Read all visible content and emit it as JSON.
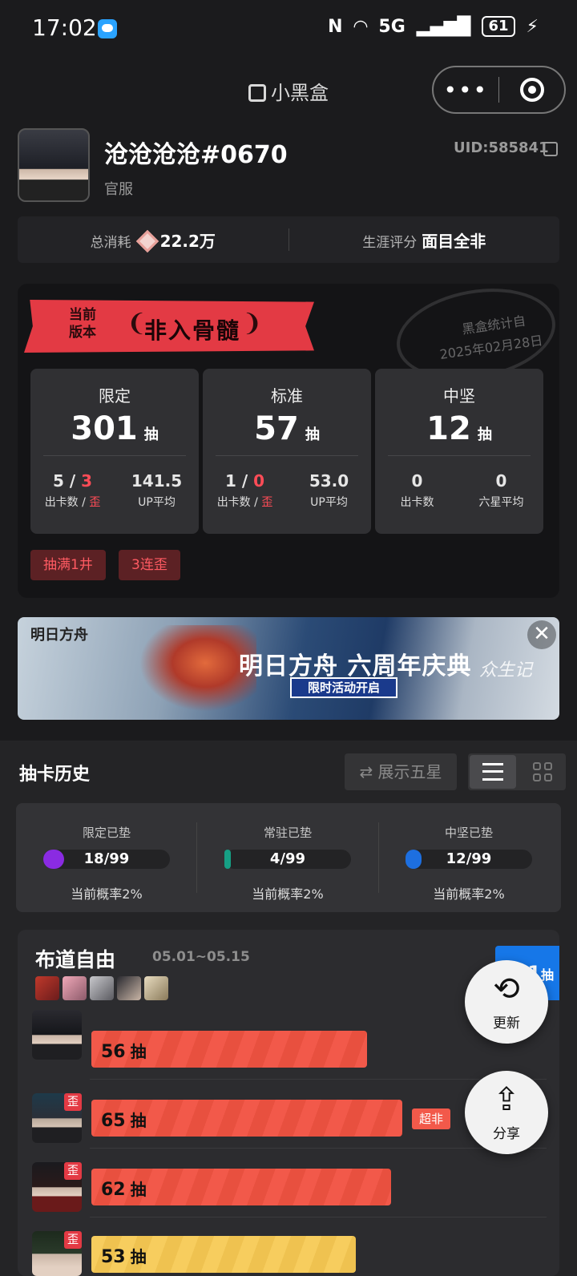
{
  "status_bar": {
    "time": "17:02",
    "network": "5G",
    "battery": "61"
  },
  "mini_program": {
    "title": "小黑盒",
    "menu_dots": "•••"
  },
  "profile": {
    "name": "沧沧沧沧#0670",
    "server": "官服",
    "uid": "UID:585841",
    "total_label": "总消耗",
    "total_value": "22.2万",
    "career_label": "生涯评分",
    "career_value": "面目全非"
  },
  "version_card": {
    "badge_small": [
      "当前",
      "版本"
    ],
    "badge_title": "非入骨髓",
    "laurel_left": "❨",
    "laurel_right": "❩",
    "stamp_line1": "黑盒统计自",
    "stamp_line2": "2025年02月28日",
    "pools": [
      {
        "name": "限定",
        "count": "301",
        "unit": "抽",
        "stat1_value": "5",
        "stat1_sep": " / ",
        "stat1_value_red": "3",
        "stat1_label": "出卡数 / ",
        "stat1_label_red": "歪",
        "stat2_value": "141.5",
        "stat2_label": "UP平均"
      },
      {
        "name": "标准",
        "count": "57",
        "unit": "抽",
        "stat1_value": "1",
        "stat1_sep": " / ",
        "stat1_value_red": "0",
        "stat1_label": "出卡数 / ",
        "stat1_label_red": "歪",
        "stat2_value": "53.0",
        "stat2_label": "UP平均"
      },
      {
        "name": "中坚",
        "count": "12",
        "unit": "抽",
        "stat1_value": "0",
        "stat1_sep": "",
        "stat1_value_red": "",
        "stat1_label": "出卡数",
        "stat1_label_red": "",
        "stat2_value": "0",
        "stat2_label": "六星平均"
      }
    ],
    "tags": [
      "抽满1井",
      "3连歪"
    ]
  },
  "promo": {
    "left_logo": "明日方舟",
    "title": "明日方舟 六周年庆典",
    "subtitle": "限时活动开启",
    "right_text": "众生记",
    "close": "✕"
  },
  "history": {
    "title": "抽卡历史",
    "show_five_star": "⇄ 展示五星",
    "pity": [
      {
        "label": "限定已垫",
        "value": "18/99",
        "rate": "当前概率2%",
        "color": "#8a2be2"
      },
      {
        "label": "常驻已垫",
        "value": "4/99",
        "rate": "当前概率2%",
        "color": "#16a085"
      },
      {
        "label": "中坚已垫",
        "value": "12/99",
        "rate": "当前概率2%",
        "color": "#1d6fe0"
      }
    ],
    "pool_card": {
      "title": "布道自由",
      "date": "05.01~05.15",
      "total": "301",
      "total_unit": "抽",
      "rows": [
        {
          "count": "56",
          "unit": "抽",
          "wai": ""
        },
        {
          "count": "65",
          "unit": "抽",
          "wai": "歪",
          "badge": "超非"
        },
        {
          "count": "62",
          "unit": "抽",
          "wai": "歪"
        },
        {
          "count": "53",
          "unit": "抽",
          "wai": "歪"
        }
      ]
    },
    "fab_refresh": {
      "icon": "⟲",
      "label": "更新"
    },
    "fab_share": {
      "icon": "⇪",
      "label": "分享"
    }
  }
}
